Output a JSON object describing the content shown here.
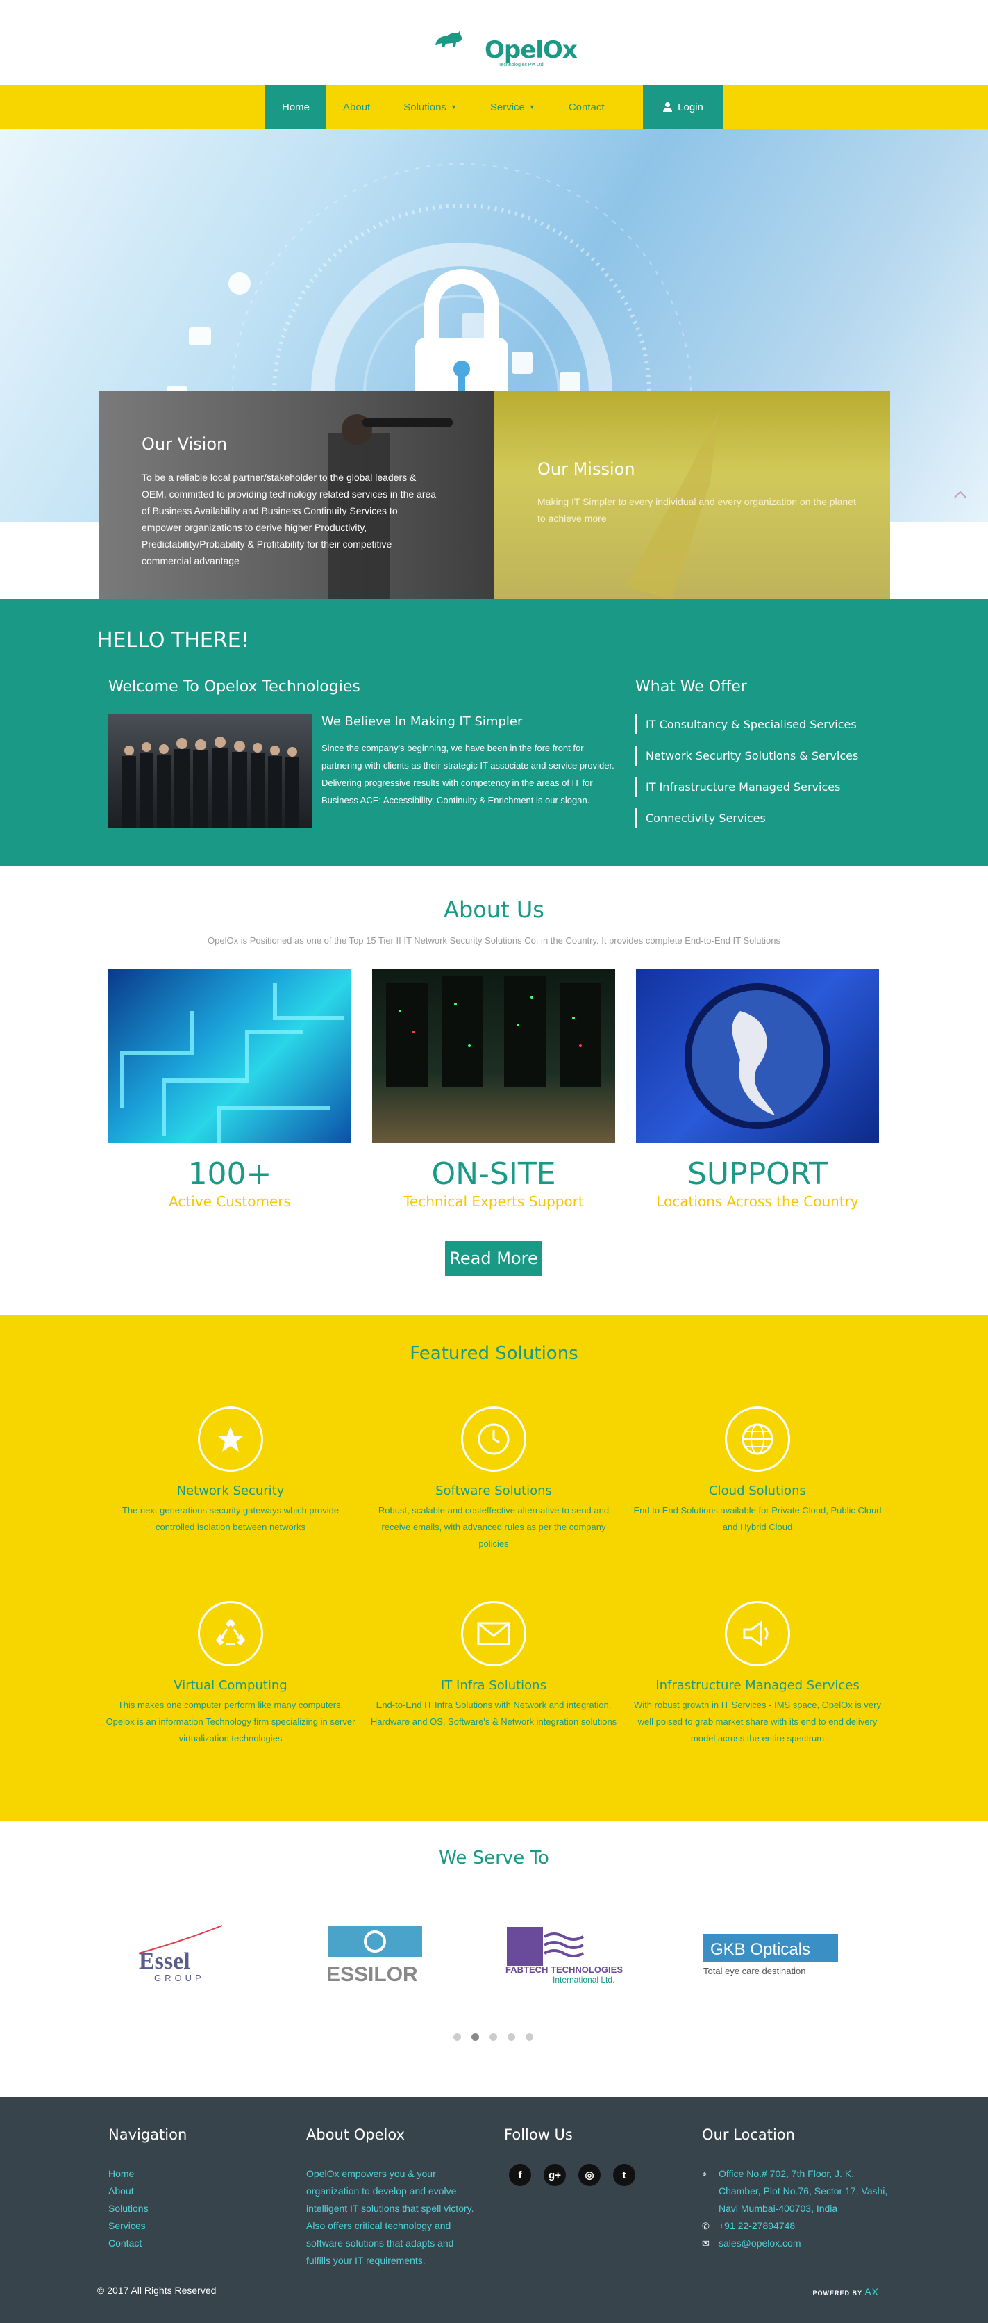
{
  "header": {
    "logo_text": "OpelOx",
    "logo_tagline": "Technologies Pvt Ltd"
  },
  "nav": {
    "items": [
      {
        "label": "Home",
        "active": true
      },
      {
        "label": "About"
      },
      {
        "label": "Solutions",
        "dropdown": true
      },
      {
        "label": "Service",
        "dropdown": true
      },
      {
        "label": "Contact"
      }
    ],
    "login": "Login"
  },
  "hero": {
    "vision_title": "Our Vision",
    "vision_text": "To be a reliable local partner/stakeholder to the global leaders & OEM, committed to providing technology related services in the area of Business Availability and Business Continuity Services to empower organizations to derive higher Productivity, Predictability/Probability & Profitability for their competitive commercial advantage",
    "mission_title": "Our Mission",
    "mission_text": "Making IT Simpler to every individual and every organization on the planet to achieve more"
  },
  "hello": {
    "title": "HELLO THERE!",
    "welcome": "Welcome To Opelox Technologies",
    "believe_title": "We Believe In Making IT Simpler",
    "believe_text": "Since the company's beginning, we have been in the fore front for partnering with clients as their strategic IT associate and service provider. Delivering progressive results with competency in the areas of IT for Business ACE: Accessibility, Continuity & Enrichment is our slogan.",
    "offer_title": "What We Offer",
    "offers": [
      "IT Consultancy & Specialised Services",
      "Network Security Solutions & Services",
      "IT Infrastructure Managed Services",
      "Connectivity Services"
    ]
  },
  "about": {
    "title": "About Us",
    "subtitle": "OpelOx is Positioned as one of the Top 15 Tier II IT Network Security Solutions Co. in the Country. It provides complete End-to-End IT Solutions",
    "stats": [
      {
        "big": "100+",
        "small": "Active Customers"
      },
      {
        "big": "ON-SITE",
        "small": "Technical Experts Support"
      },
      {
        "big": "SUPPORT",
        "small": "Locations Across the Country"
      }
    ],
    "read_more": "Read More"
  },
  "featured": {
    "title": "Featured Solutions",
    "items": [
      {
        "title": "Network Security",
        "text": "The next generations security gateways which provide controlled isolation between networks",
        "icon": "star-icon"
      },
      {
        "title": "Software Solutions",
        "text": "Robust, scalable and costeffective alternative to send and receive emails, with advanced rules as per the company policies",
        "icon": "clock-icon"
      },
      {
        "title": "Cloud Solutions",
        "text": "End to End Solutions available for Private Cloud, Public Cloud and Hybrid Cloud",
        "icon": "globe-icon"
      },
      {
        "title": "Virtual Computing",
        "text": "This makes one computer perform like many computers. Opelox is an information Technology firm specializing in server virtualization technologies",
        "icon": "recycle-icon"
      },
      {
        "title": "IT Infra Solutions",
        "text": "End-to-End IT Infra Solutions with Network and integration, Hardware and OS, Software's & Network integration solutions",
        "icon": "envelope-icon"
      },
      {
        "title": "Infrastructure Managed Services",
        "text": "With robust growth in IT Services - IMS space, OpelOx is very well poised to grab market share with its end to end delivery model across the entire spectrum",
        "icon": "megaphone-icon"
      }
    ]
  },
  "serve": {
    "title": "We Serve To",
    "clients": [
      {
        "name": "Essel",
        "sub": "GROUP"
      },
      {
        "name": "ESSILOR"
      },
      {
        "name": "FABTECH TECHNOLOGIES",
        "sub": "International Ltd."
      },
      {
        "name": "GKB Opticals",
        "sub": "Total eye care destination"
      }
    ]
  },
  "footer": {
    "nav_title": "Navigation",
    "nav_links": [
      "Home",
      "About",
      "Solutions",
      "Services",
      "Contact"
    ],
    "about_title": "About Opelox",
    "about_text": "OpelOx empowers you & your organization to develop and evolve intelligent IT solutions that spell victory. Also offers critical technology and software solutions that adapts and fulfills your IT requirements.",
    "follow_title": "Follow Us",
    "social": [
      "f",
      "g+",
      "◎",
      "t"
    ],
    "location_title": "Our Location",
    "address": "Office No.# 702, 7th Floor, J. K. Chamber, Plot No.76, Sector 17, Vashi, Navi Mumbai-400703, India",
    "phone": "+91 22-27894748",
    "email": "sales@opelox.com",
    "copyright": "© 2017 All Rights Reserved",
    "powered_by": "POWERED BY",
    "powered_brand": "AX"
  },
  "colors": {
    "teal": "#1a9a86",
    "yellow": "#f7d600",
    "footer": "#37444c"
  }
}
